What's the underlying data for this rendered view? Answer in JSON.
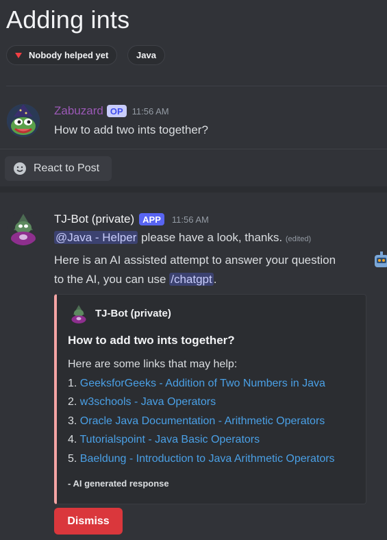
{
  "thread": {
    "title": "Adding ints",
    "tags": [
      {
        "label": "Nobody helped yet",
        "icon": "red-triangle-icon"
      },
      {
        "label": "Java"
      }
    ]
  },
  "post": {
    "author": "Zabuzard",
    "author_color": "#9b59b6",
    "badge": "OP",
    "time": "11:56 AM",
    "text": "How to add two ints together?",
    "react_label": "React to Post"
  },
  "reply": {
    "author": "TJ-Bot (private)",
    "badge": "APP",
    "time": "11:56 AM",
    "mention": "@Java - Helper",
    "line1_rest": " please have a look, thanks.",
    "edited": "(edited)",
    "line2": "Here is an AI assisted attempt to answer your question",
    "line3_prefix": "to the AI, you can use ",
    "command": "/chatgpt",
    "line3_suffix": "."
  },
  "embed": {
    "author": "TJ-Bot (private)",
    "title": "How to add two ints together?",
    "intro": "Here are some links that may help:",
    "links": [
      {
        "num": "1.",
        "text": "GeeksforGeeks - Addition of Two Numbers in Java"
      },
      {
        "num": "2.",
        "text": "w3schools - Java Operators"
      },
      {
        "num": "3.",
        "text": "Oracle Java Documentation - Arithmetic Operators"
      },
      {
        "num": "4.",
        "text": "Tutorialspoint - Java Basic Operators"
      },
      {
        "num": "5.",
        "text": "Baeldung - Introduction to Java Arithmetic Operators"
      }
    ],
    "footer": "- AI generated response",
    "accent": "#f5a4a4"
  },
  "dismiss_label": "Dismiss"
}
